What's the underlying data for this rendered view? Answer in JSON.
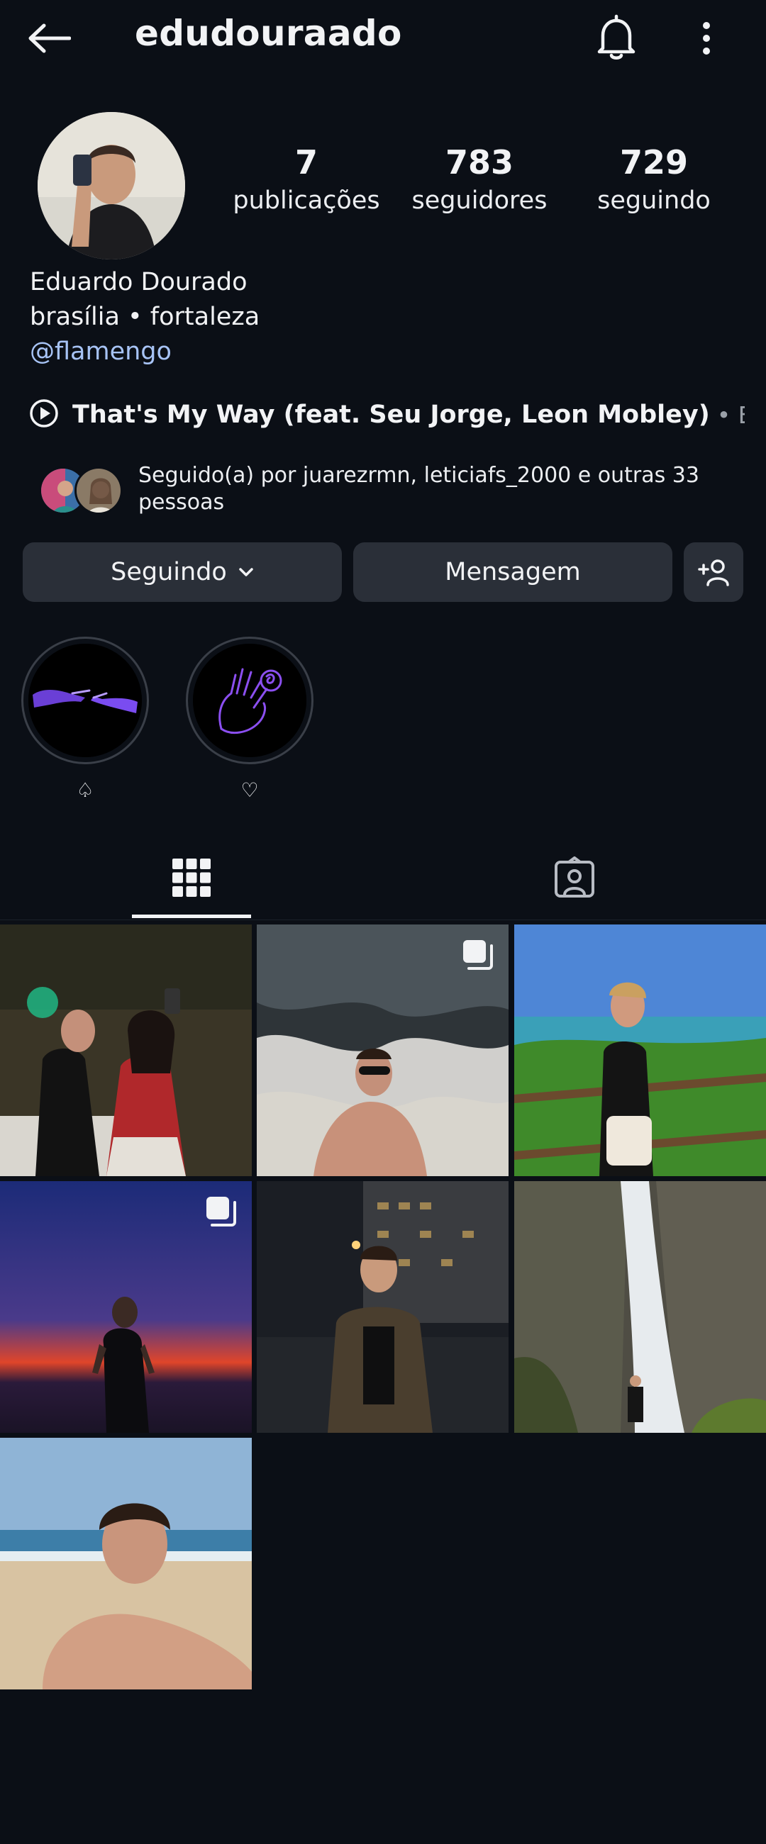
{
  "header": {
    "username": "edudouraado"
  },
  "stats": [
    {
      "value": "7",
      "label": "publicações"
    },
    {
      "value": "783",
      "label": "seguidores"
    },
    {
      "value": "729",
      "label": "seguindo"
    }
  ],
  "bio": {
    "name": "Eduardo Dourado",
    "line": "brasília • fortaleza",
    "mention": "@flamengo"
  },
  "music": {
    "track": "That's My Way (feat. Seu Jorge, Leon Mobley)",
    "artist": "• Edi Rock,..."
  },
  "followed_by": {
    "text": "Seguido(a) por juarezrmn, leticiafs_2000 e outras 33 pessoas"
  },
  "actions": {
    "following_label": "Seguindo",
    "message_label": "Mensagem"
  },
  "highlights": [
    {
      "label": "♤"
    },
    {
      "label": "♡"
    }
  ],
  "tabs": {
    "grid_icon": "grid-icon",
    "tagged_icon": "tagged-icon"
  },
  "colors": {
    "background": "#0b0f16",
    "button": "#2a2f38",
    "link": "#a7c3f5"
  }
}
